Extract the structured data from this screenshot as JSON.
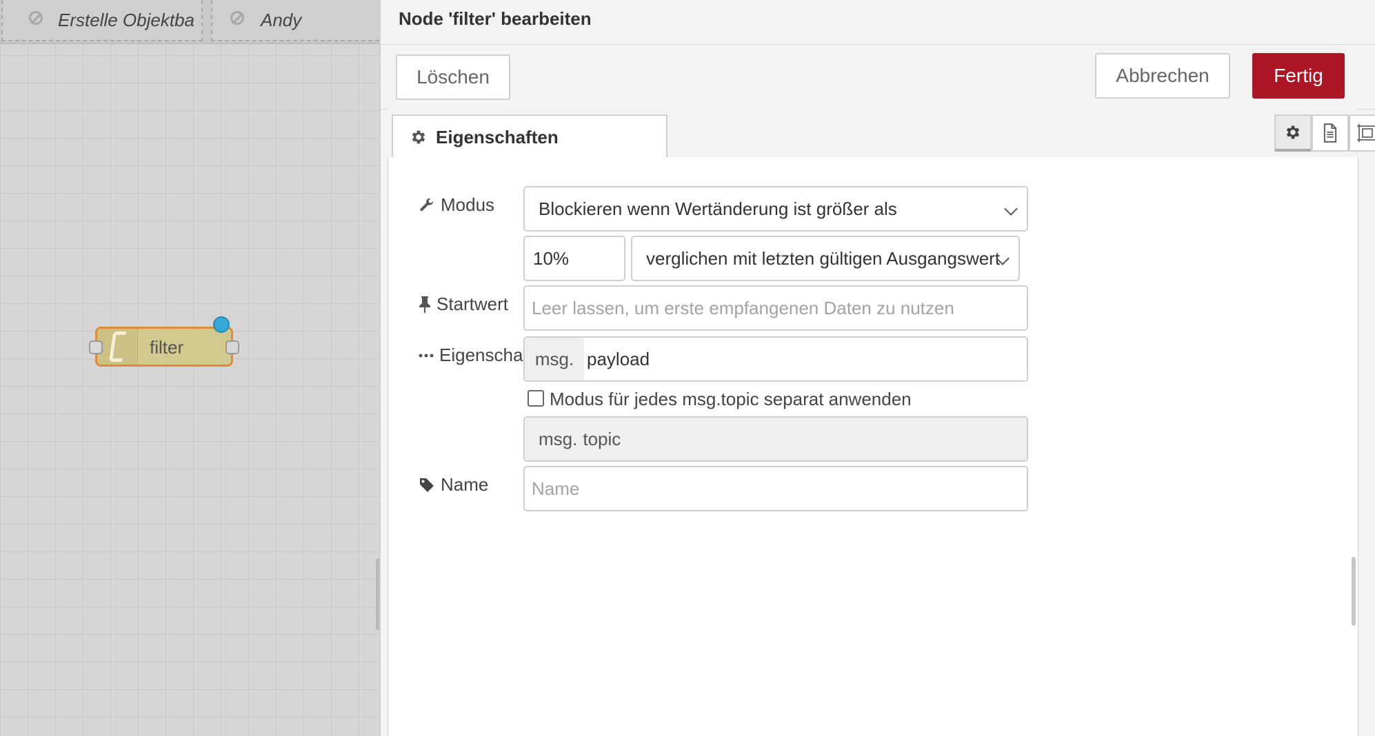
{
  "workspace": {
    "tabs": [
      {
        "label": "Erstelle Objektba"
      },
      {
        "label": "Andy"
      }
    ],
    "node": {
      "label": "filter"
    }
  },
  "tray": {
    "title": "Node 'filter' bearbeiten",
    "buttons": {
      "delete": "Löschen",
      "cancel": "Abbrechen",
      "done": "Fertig"
    },
    "tabs": {
      "properties": "Eigenschaften"
    },
    "form": {
      "mode_label": "Modus",
      "mode_value": "Blockieren wenn Wertänderung ist größer als",
      "threshold_value": "10%",
      "compare_value": "verglichen mit letzten gültigen Ausgangswert",
      "start_label": "Startwert",
      "start_placeholder": "Leer lassen, um erste empfangenen Daten zu nutzen",
      "property_label": "Eigenschaft",
      "property_prefix": "msg.",
      "property_value": "payload",
      "separate_label": "Modus für jedes msg.topic separat anwenden",
      "topic_prefix": "msg.",
      "topic_value": "topic",
      "name_label": "Name",
      "name_placeholder": "Name"
    }
  },
  "colors": {
    "primary_button": "#ad1625",
    "node_fill": "#d2c98e",
    "node_border": "#e08a3c",
    "changed_dot": "#36a9d8"
  }
}
